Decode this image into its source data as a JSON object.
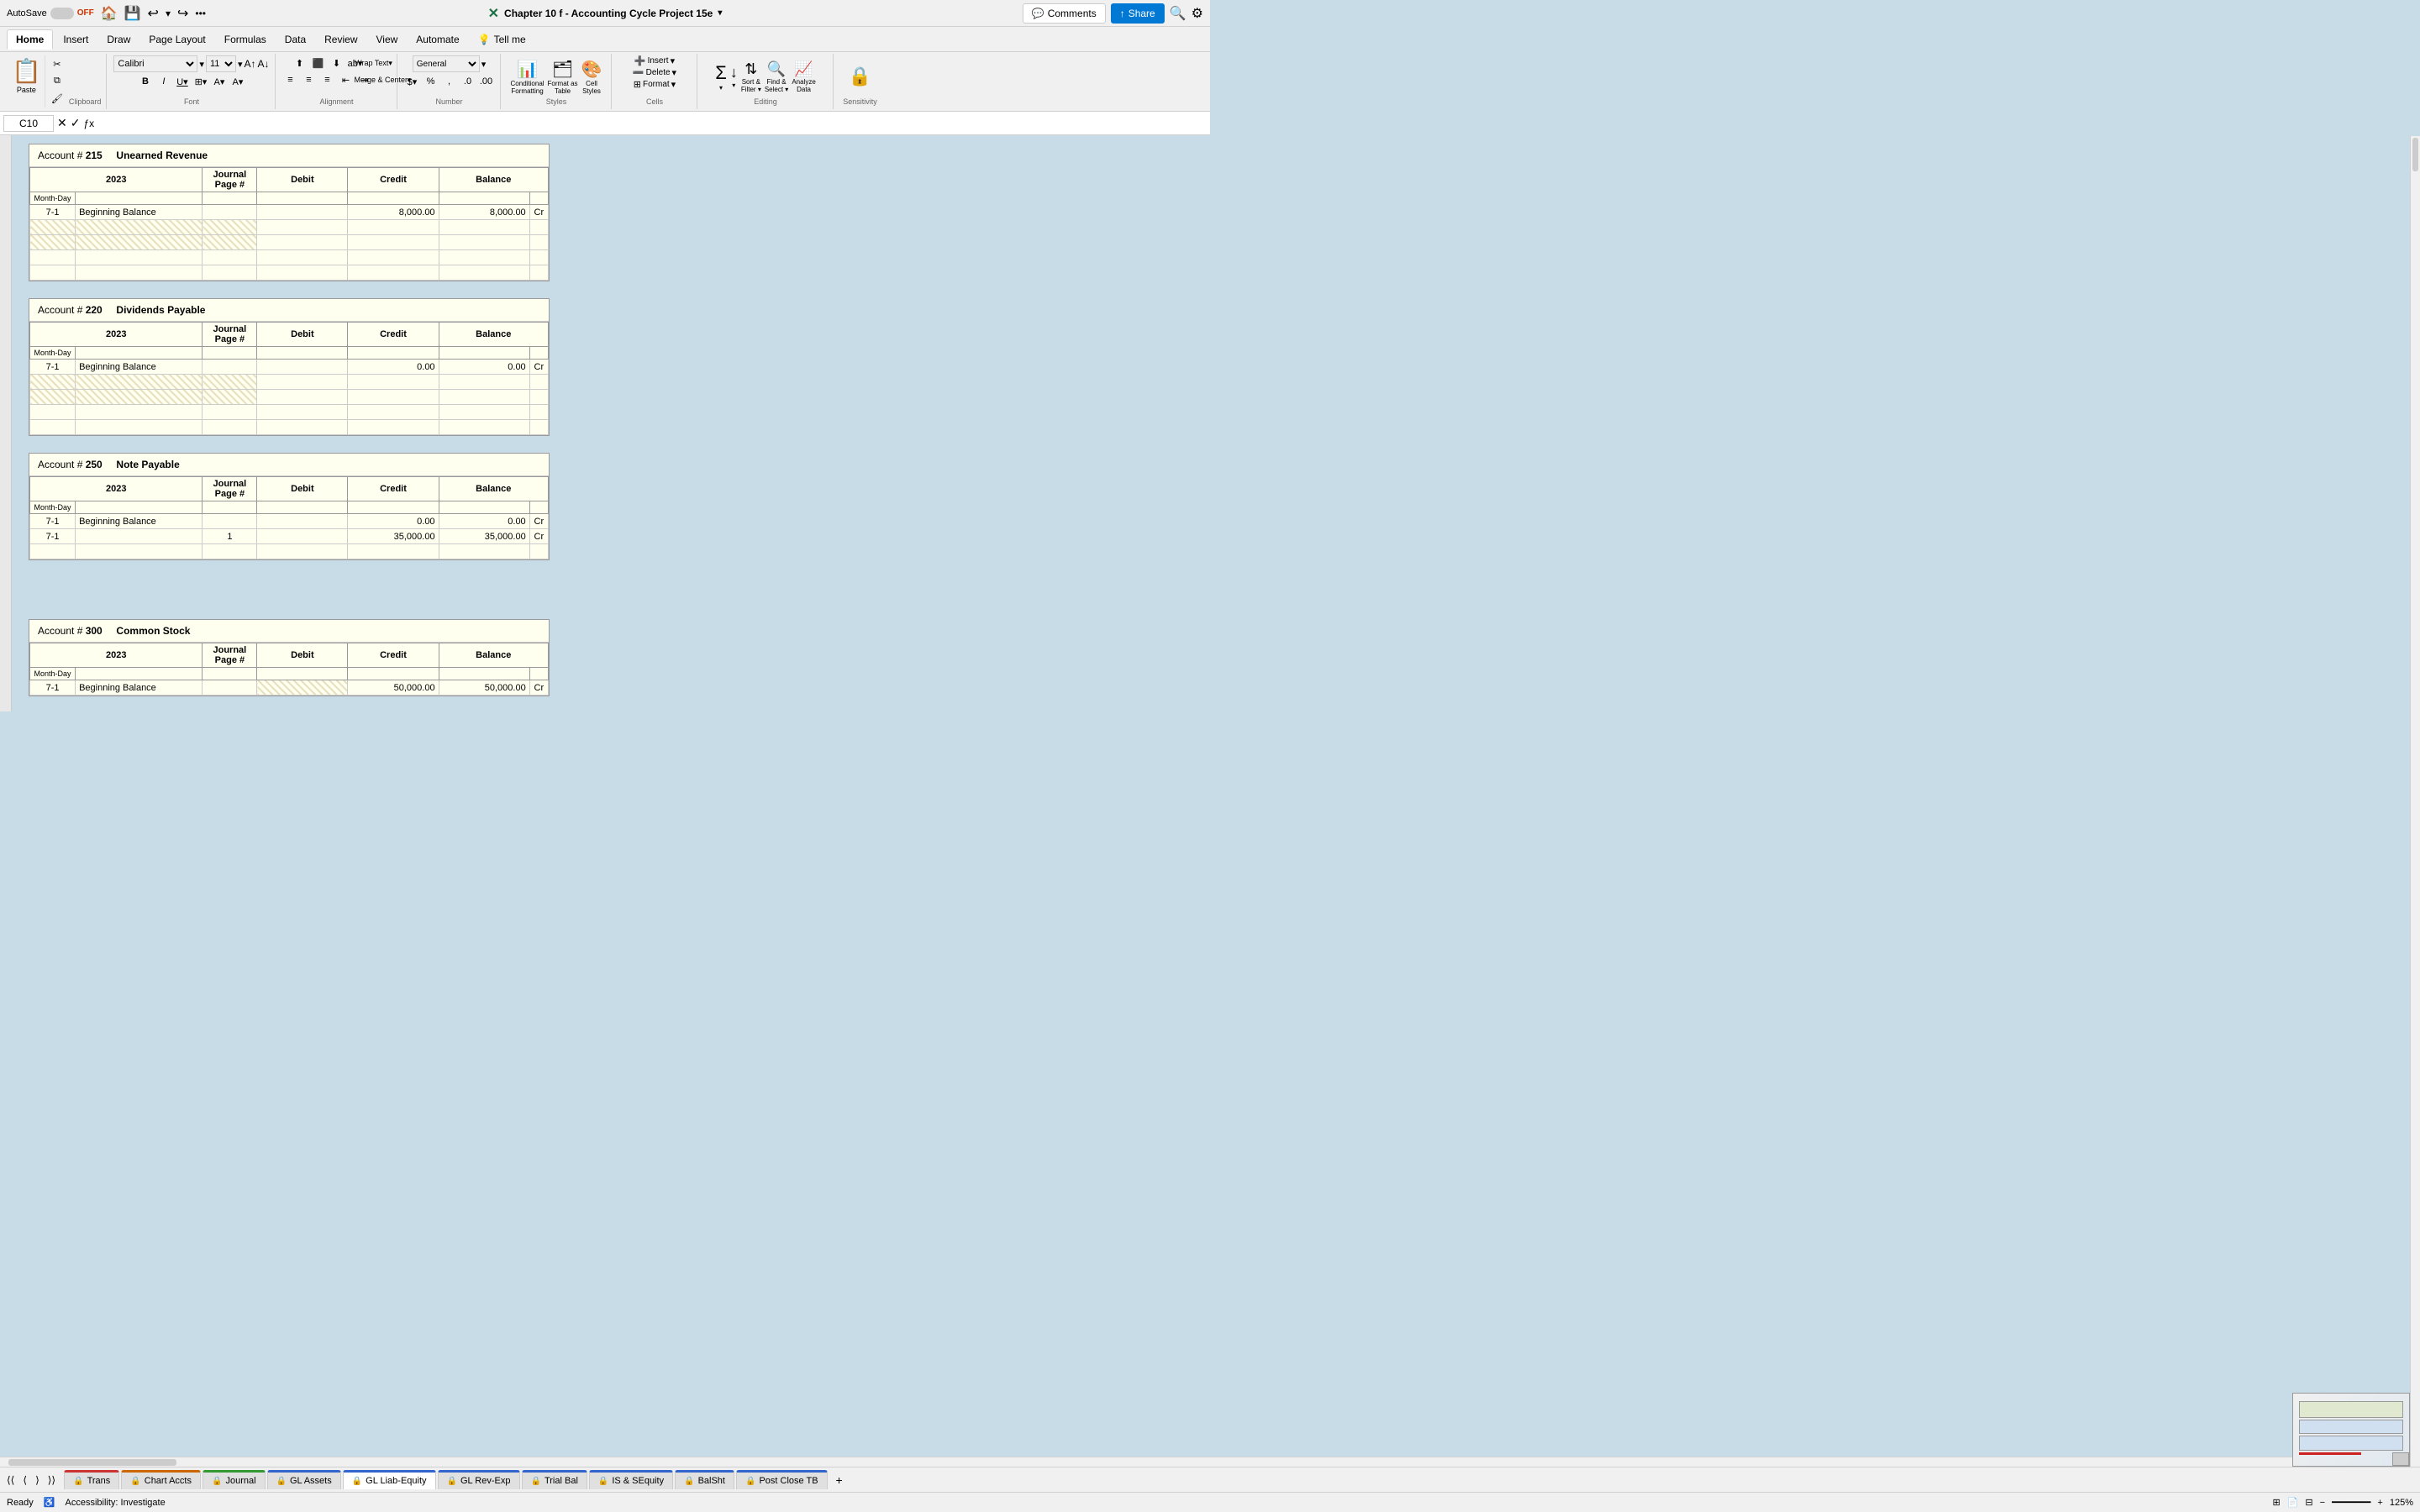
{
  "titlebar": {
    "autosave_label": "AutoSave",
    "autosave_state": "OFF",
    "title": "Chapter 10 f - Accounting Cycle Project 15e",
    "search_label": "Tell me"
  },
  "ribbon": {
    "tabs": [
      "Home",
      "Insert",
      "Draw",
      "Page Layout",
      "Formulas",
      "Data",
      "Review",
      "View",
      "Automate"
    ],
    "active_tab": "Home",
    "groups": {
      "clipboard": {
        "label": "Clipboard",
        "paste": "Paste"
      },
      "font": {
        "label": "Font",
        "bold": "B",
        "italic": "I",
        "underline": "U"
      },
      "alignment": {
        "label": "Alignment",
        "wrap_text": "Wrap Text",
        "merge_center": "Merge & Center"
      },
      "number": {
        "label": "Number"
      },
      "styles": {
        "conditional": "Conditional Formatting",
        "format_table": "Format as Table",
        "cell_styles": "Cell Styles",
        "label": "Styles"
      },
      "cells": {
        "insert": "Insert",
        "delete": "Delete",
        "format": "Format",
        "label": "Cells"
      },
      "editing": {
        "sum": "Σ",
        "sort_filter": "Sort & Filter",
        "find_select": "Find & Select",
        "analyze": "Analyze Data",
        "label": "Editing"
      },
      "sensitivity": {
        "label": "Sensitivity"
      }
    }
  },
  "formula_bar": {
    "cell_ref": "C10",
    "formula": ""
  },
  "tell_me": "Tell me",
  "comments_label": "Comments",
  "share_label": "Share",
  "ledgers": [
    {
      "id": "ledger1",
      "account_no": "215",
      "account_name": "Unearned Revenue",
      "year": "2023",
      "rows": [
        {
          "date": "7-1",
          "desc": "Beginning Balance",
          "journal": "",
          "debit": "",
          "credit": "8,000.00",
          "balance": "8,000.00",
          "cr_dr": "Cr",
          "striped": false
        },
        {
          "date": "",
          "desc": "",
          "journal": "",
          "debit": "",
          "credit": "",
          "balance": "",
          "cr_dr": "",
          "striped": true
        },
        {
          "date": "",
          "desc": "",
          "journal": "",
          "debit": "",
          "credit": "",
          "balance": "",
          "cr_dr": "",
          "striped": true
        },
        {
          "date": "",
          "desc": "",
          "journal": "",
          "debit": "",
          "credit": "",
          "balance": "",
          "cr_dr": "",
          "striped": false
        },
        {
          "date": "",
          "desc": "",
          "journal": "",
          "debit": "",
          "credit": "",
          "balance": "",
          "cr_dr": "",
          "striped": false
        }
      ]
    },
    {
      "id": "ledger2",
      "account_no": "220",
      "account_name": "Dividends Payable",
      "year": "2023",
      "rows": [
        {
          "date": "7-1",
          "desc": "Beginning Balance",
          "journal": "",
          "debit": "",
          "credit": "0.00",
          "balance": "0.00",
          "cr_dr": "Cr",
          "striped": false
        },
        {
          "date": "",
          "desc": "",
          "journal": "",
          "debit": "",
          "credit": "",
          "balance": "",
          "cr_dr": "",
          "striped": true
        },
        {
          "date": "",
          "desc": "",
          "journal": "",
          "debit": "",
          "credit": "",
          "balance": "",
          "cr_dr": "",
          "striped": true
        },
        {
          "date": "",
          "desc": "",
          "journal": "",
          "debit": "",
          "credit": "",
          "balance": "",
          "cr_dr": "",
          "striped": false
        },
        {
          "date": "",
          "desc": "",
          "journal": "",
          "debit": "",
          "credit": "",
          "balance": "",
          "cr_dr": "",
          "striped": false
        }
      ]
    },
    {
      "id": "ledger3",
      "account_no": "250",
      "account_name": "Note Payable",
      "year": "2023",
      "rows": [
        {
          "date": "7-1",
          "desc": "Beginning Balance",
          "journal": "",
          "debit": "",
          "credit": "0.00",
          "balance": "0.00",
          "cr_dr": "Cr",
          "striped": false
        },
        {
          "date": "7-1",
          "desc": "",
          "journal": "1",
          "debit": "",
          "credit": "35,000.00",
          "balance": "35,000.00",
          "cr_dr": "Cr",
          "striped": false
        },
        {
          "date": "",
          "desc": "",
          "journal": "",
          "debit": "",
          "credit": "",
          "balance": "",
          "cr_dr": "",
          "striped": false
        }
      ]
    },
    {
      "id": "ledger4",
      "account_no": "300",
      "account_name": "Common Stock",
      "year": "2023",
      "rows": [
        {
          "date": "7-1",
          "desc": "Beginning Balance",
          "journal": "",
          "debit": "",
          "credit": "50,000.00",
          "balance": "50,000.00",
          "cr_dr": "Cr",
          "striped": false
        }
      ]
    }
  ],
  "sheet_tabs": [
    {
      "id": "trans",
      "label": "Trans",
      "locked": true,
      "color": "red",
      "active": false
    },
    {
      "id": "chart-accts",
      "label": "Chart Accts",
      "locked": true,
      "color": "orange",
      "active": false
    },
    {
      "id": "journal",
      "label": "Journal",
      "locked": true,
      "color": "green",
      "active": false
    },
    {
      "id": "gl-assets",
      "label": "GL Assets",
      "locked": true,
      "color": "blue",
      "active": false
    },
    {
      "id": "gl-liab-equity",
      "label": "GL Liab-Equity",
      "locked": true,
      "color": "blue",
      "active": true
    },
    {
      "id": "gl-rev-exp",
      "label": "GL Rev-Exp",
      "locked": true,
      "color": "blue",
      "active": false
    },
    {
      "id": "trial-bal",
      "label": "Trial Bal",
      "locked": true,
      "color": "blue",
      "active": false
    },
    {
      "id": "is-sequity",
      "label": "IS & SEquity",
      "locked": true,
      "color": "blue",
      "active": false
    },
    {
      "id": "balsht",
      "label": "BalSht",
      "locked": true,
      "color": "blue",
      "active": false
    },
    {
      "id": "post-close-tb",
      "label": "Post Close TB",
      "locked": true,
      "color": "blue",
      "active": false
    }
  ],
  "status": {
    "ready": "Ready",
    "accessibility": "Accessibility: Investigate",
    "zoom": "125%"
  }
}
